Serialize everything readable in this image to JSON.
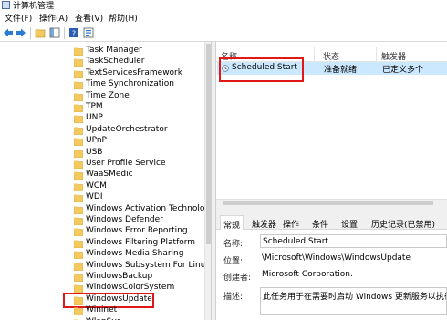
{
  "window": {
    "title": "计算机管理"
  },
  "menu": {
    "items": [
      "文件(F)",
      "操作(A)",
      "查看(V)",
      "帮助(H)"
    ]
  },
  "tree": {
    "items": [
      "Task Manager",
      "TaskScheduler",
      "TextServicesFramework",
      "Time Synchronization",
      "Time Zone",
      "TPM",
      "UNP",
      "UpdateOrchestrator",
      "UPnP",
      "USB",
      "User Profile Service",
      "WaaSMedic",
      "WCM",
      "WDI",
      "Windows Activation Technologies",
      "Windows Defender",
      "Windows Error Reporting",
      "Windows Filtering Platform",
      "Windows Media Sharing",
      "Windows Subsystem For Linux",
      "WindowsBackup",
      "WindowsColorSystem",
      "WindowsUpdate",
      "Wininet",
      "WlanSvc"
    ],
    "selected": "WindowsUpdate"
  },
  "task_list": {
    "columns": [
      "名称",
      "状态",
      "触发器"
    ],
    "rows": [
      {
        "name": "Scheduled Start",
        "status": "准备就绪",
        "trigger": "已定义多个"
      }
    ]
  },
  "tabs": [
    "常规",
    "触发器",
    "操作",
    "条件",
    "设置",
    "历史记录(已禁用)"
  ],
  "details": {
    "name_label": "名称:",
    "name_value": "Scheduled Start",
    "location_label": "位置:",
    "location_value": "\\Microsoft\\Windows\\WindowsUpdate",
    "author_label": "创建者:",
    "author_value": "Microsoft Corporation.",
    "desc_label": "描述:",
    "desc_value": "此任务用于在需要时启动 Windows 更新服务以执行计划"
  },
  "colors": {
    "highlight": "#e01818",
    "selection": "#cce8ff",
    "folder": "#f4c95d",
    "accent": "#1e72c8"
  }
}
